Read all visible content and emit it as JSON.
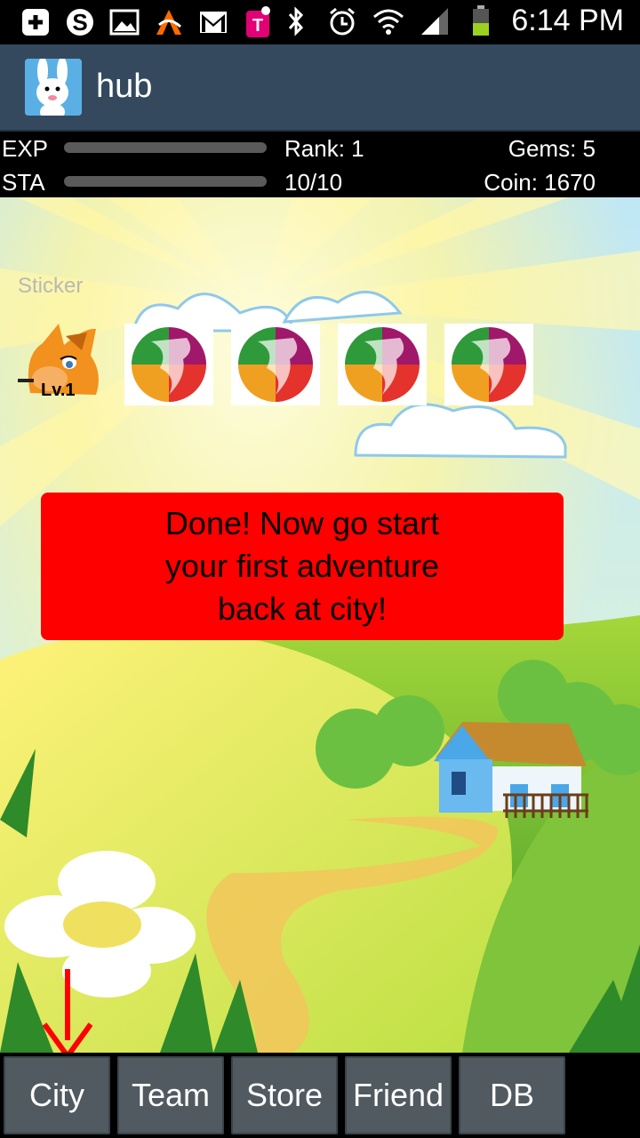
{
  "status_bar": {
    "time": "6:14 PM",
    "left_icons": [
      "add-icon",
      "skype-icon",
      "image-icon",
      "avast-icon",
      "gmail-icon",
      "tmobile-icon"
    ],
    "right_icons": [
      "bluetooth-icon",
      "alarm-icon",
      "wifi-icon",
      "signal-icon",
      "battery-icon"
    ]
  },
  "app": {
    "title": "hub"
  },
  "hud": {
    "exp_label": "EXP",
    "sta_label": "STA",
    "rank": "Rank: 1",
    "stamina": "10/10",
    "gems": "Gems: 5",
    "coin": "Coin: 1670",
    "exp_fill": 0,
    "sta_fill": 0
  },
  "sticker_section": {
    "label": "Sticker",
    "character_level": "Lv.1",
    "slots": [
      "globe-sticker",
      "globe-sticker",
      "globe-sticker",
      "globe-sticker"
    ]
  },
  "message": "Done! Now go start\nyour first adventure\nback at city!",
  "tabs": [
    "City",
    "Team",
    "Store",
    "Friend",
    "DB"
  ],
  "colors": {
    "action_bar": "#34495e",
    "message_bg": "#ff0000",
    "tab_bg": "#505a60",
    "arrow": "#ff0000"
  }
}
